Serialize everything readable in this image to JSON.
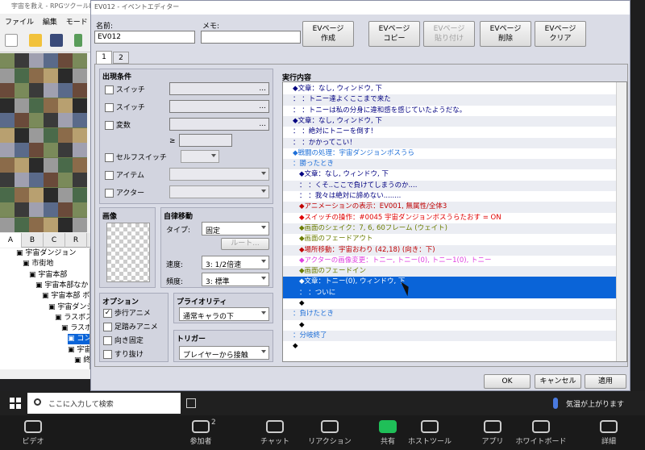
{
  "app": {
    "title": "宇宙を救え - RPGツクールMV",
    "menu": [
      "ファイル",
      "編集",
      "モード"
    ],
    "tile_tabs": [
      "A",
      "B",
      "C",
      "R"
    ],
    "map_tree": [
      {
        "label": "宇宙ダンジョン",
        "indent": 0
      },
      {
        "label": "市街地",
        "indent": 1
      },
      {
        "label": "宇宙本部",
        "indent": 2
      },
      {
        "label": "宇宙本部なか",
        "indent": 3
      },
      {
        "label": "宇宙本部 ボ",
        "indent": 4
      },
      {
        "label": "宇宙ダンジ",
        "indent": 5
      },
      {
        "label": "ラスボス",
        "indent": 6
      },
      {
        "label": "ラスボス",
        "indent": 7
      },
      {
        "label": "コンピ",
        "indent": 8,
        "selected": true
      },
      {
        "label": "宇宙お",
        "indent": 8
      },
      {
        "label": "終わ",
        "indent": 9
      }
    ]
  },
  "dialog": {
    "title": "EV012 - イベントエディター",
    "name_label": "名前:",
    "name_value": "EV012",
    "memo_label": "メモ:",
    "memo_value": "",
    "buttons": [
      {
        "line1": "EVページ",
        "line2": "作成",
        "enabled": true
      },
      {
        "line1": "EVページ",
        "line2": "コピー",
        "enabled": true
      },
      {
        "line1": "EVページ",
        "line2": "貼り付け",
        "enabled": false
      },
      {
        "line1": "EVページ",
        "line2": "削除",
        "enabled": true
      },
      {
        "line1": "EVページ",
        "line2": "クリア",
        "enabled": true
      }
    ],
    "page_tabs": [
      "1",
      "2"
    ],
    "conditions": {
      "title": "出現条件",
      "switch1": "スイッチ",
      "switch2": "スイッチ",
      "variable": "変数",
      "gte": "≥",
      "self_switch": "セルフスイッチ",
      "item": "アイテム",
      "actor": "アクター",
      "ellipsis": "..."
    },
    "image": {
      "title": "画像"
    },
    "autonomous": {
      "title": "自律移動",
      "type_label": "タイプ:",
      "type_value": "固定",
      "route_button": "ルート...",
      "speed_label": "速度:",
      "speed_value": "3: 1/2倍速",
      "freq_label": "頻度:",
      "freq_value": "3: 標準"
    },
    "options": {
      "title": "オプション",
      "items": [
        {
          "label": "歩行アニメ",
          "checked": true
        },
        {
          "label": "足踏みアニメ",
          "checked": false
        },
        {
          "label": "向き固定",
          "checked": false
        },
        {
          "label": "すり抜け",
          "checked": false
        }
      ]
    },
    "priority": {
      "title": "プライオリティ",
      "value": "通常キャラの下"
    },
    "trigger": {
      "title": "トリガー",
      "value": "プレイヤーから接触"
    },
    "contents": {
      "title": "実行内容",
      "lines": [
        {
          "t": "◆文章：なし, ウィンドウ, 下",
          "c": "#000080",
          "i": 1
        },
        {
          "t": "：            ：トニー達よくここまで来た",
          "c": "#000080",
          "i": 1
        },
        {
          "t": "：            ：トニーは私の分身に違和感を感じていたようだな。",
          "c": "#000080",
          "i": 1
        },
        {
          "t": "◆文章：なし, ウィンドウ, 下",
          "c": "#000080",
          "i": 1
        },
        {
          "t": "：            ：絶対にトニーを倒す！",
          "c": "#000080",
          "i": 1
        },
        {
          "t": "：            ：かかってこい！",
          "c": "#000080",
          "i": 1
        },
        {
          "t": "◆戦闘の処理：宇宙ダンジョンボスうら",
          "c": "#1e6fd8",
          "i": 1
        },
        {
          "t": "：勝ったとき",
          "c": "#1e6fd8",
          "i": 1
        },
        {
          "t": "◆文章：なし, ウィンドウ, 下",
          "c": "#000080",
          "i": 2
        },
        {
          "t": "：            ：くそ..ここで負けてしまうのか....",
          "c": "#000080",
          "i": 2
        },
        {
          "t": "：            ：我々は絶対に諦めない........",
          "c": "#000080",
          "i": 2
        },
        {
          "t": "◆アニメーションの表示：EV001, 無属性/全体3",
          "c": "#c00000",
          "i": 2
        },
        {
          "t": "◆スイッチの操作：#0045 宇宙ダンジョンボスうらたおす = ON",
          "c": "#e00000",
          "i": 2
        },
        {
          "t": "◆画面のシェイク：7, 6, 60フレーム (ウェイト)",
          "c": "#6b7d00",
          "i": 2
        },
        {
          "t": "◆画面のフェードアウト",
          "c": "#6b7d00",
          "i": 2
        },
        {
          "t": "◆場所移動：宇宙おわり (42,18) (向き：下)",
          "c": "#c00000",
          "i": 2
        },
        {
          "t": "◆アクターの画像変更：トニー, トニー(0), トニー1(0), トニー",
          "c": "#e040e0",
          "i": 2
        },
        {
          "t": "◆画面のフェードイン",
          "c": "#6b7d00",
          "i": 2
        },
        {
          "t": "◆文章：トニー(0), ウィンドウ, 下",
          "c": "#fff",
          "i": 2,
          "sel": true
        },
        {
          "t": "：            ：ついに",
          "c": "#fff",
          "i": 2,
          "sel": true
        },
        {
          "t": "◆",
          "c": "#000",
          "i": 2
        },
        {
          "t": "：負けたとき",
          "c": "#1e6fd8",
          "i": 1
        },
        {
          "t": "◆",
          "c": "#000",
          "i": 2
        },
        {
          "t": "：分岐終了",
          "c": "#1e6fd8",
          "i": 1
        },
        {
          "t": "◆",
          "c": "#000",
          "i": 1
        }
      ]
    },
    "footer": {
      "ok": "OK",
      "cancel": "キャンセル",
      "apply": "適用"
    }
  },
  "taskbar": {
    "search_placeholder": "ここに入力して検索",
    "weather": "気温が上がります"
  },
  "zoom": {
    "items": [
      {
        "label": "ビデオ",
        "icon": "video-icon"
      },
      {
        "label": "参加者",
        "icon": "participants-icon",
        "badge": "2"
      },
      {
        "label": "チャット",
        "icon": "chat-icon"
      },
      {
        "label": "リアクション",
        "icon": "reaction-icon"
      },
      {
        "label": "共有",
        "icon": "share-icon"
      },
      {
        "label": "ホストツール",
        "icon": "shield-icon"
      },
      {
        "label": "アプリ",
        "icon": "apps-icon"
      },
      {
        "label": "ホワイトボード",
        "icon": "whiteboard-icon"
      },
      {
        "label": "詳細",
        "icon": "more-icon"
      }
    ]
  },
  "colors": {
    "accent": "#0a64d8",
    "share_green": "#1fbf58"
  }
}
